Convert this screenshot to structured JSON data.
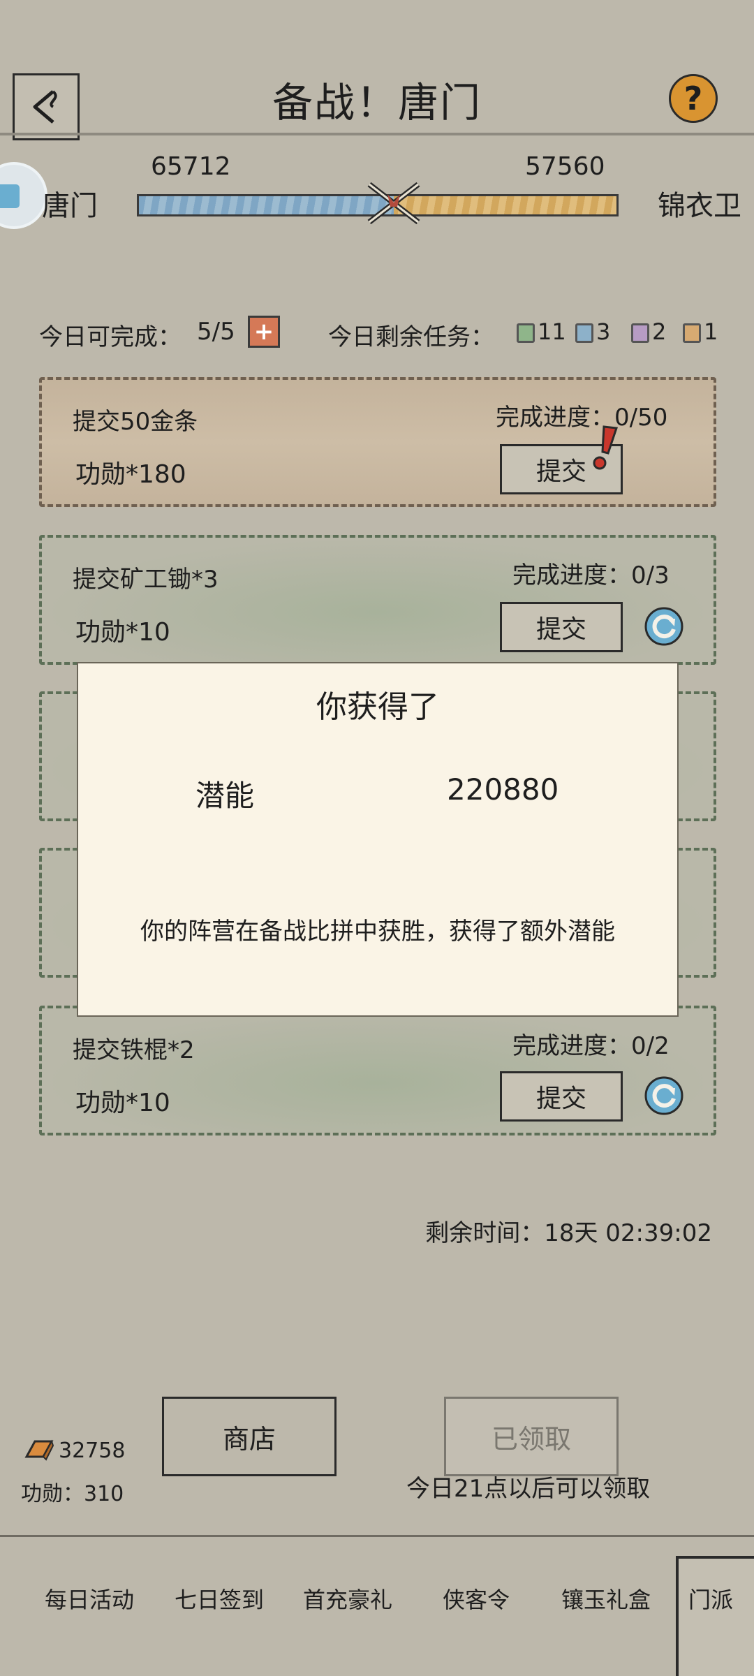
{
  "header": {
    "title": "备战！唐门"
  },
  "versus": {
    "left": {
      "name": "唐门",
      "score": "65712"
    },
    "right": {
      "name": "锦衣卫",
      "score": "57560"
    },
    "left_share": 0.533
  },
  "stats": {
    "daily_label": "今日可完成：",
    "daily_value": "5/5",
    "remaining_label": "今日剩余任务：",
    "chips": [
      {
        "color": "#8fb58a",
        "count": "11"
      },
      {
        "color": "#8db1c9",
        "count": "3"
      },
      {
        "color": "#b79cc4",
        "count": "2"
      },
      {
        "color": "#d7aa72",
        "count": "1"
      }
    ]
  },
  "tasks": [
    {
      "name": "提交50金条",
      "reward": "功勋*180",
      "progress": "完成进度：0/50",
      "button": "提交"
    },
    {
      "name": "提交矿工锄*3",
      "reward": "功勋*10",
      "progress": "完成进度：0/3",
      "button": "提交"
    },
    {
      "name": "提交铁棍*2",
      "reward": "功勋*10",
      "progress": "完成进度：0/2",
      "button": "提交"
    }
  ],
  "dialog": {
    "title": "你获得了",
    "item_label": "潜能",
    "item_value": "220880",
    "message": "你的阵营在备战比拼中获胜，获得了额外潜能"
  },
  "timer": "剩余时间：18天 02:39:02",
  "footer": {
    "gold_amount": "32758",
    "merit": "功勋：310",
    "shop_button": "商店",
    "claimed_button": "已领取",
    "claim_hint": "今日21点以后可以领取"
  },
  "nav": [
    "每日活动",
    "七日签到",
    "首充豪礼",
    "侠客令",
    "镶玉礼盒",
    "门派"
  ]
}
